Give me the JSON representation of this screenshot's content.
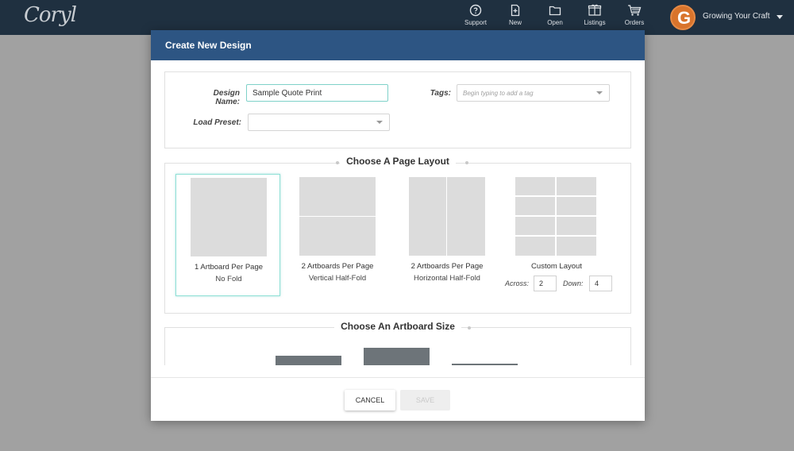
{
  "app": {
    "logo_text": "Coryl"
  },
  "nav": {
    "items": [
      {
        "label": "Support",
        "icon": "question-circle-icon"
      },
      {
        "label": "New",
        "icon": "new-file-icon"
      },
      {
        "label": "Open",
        "icon": "folder-icon"
      },
      {
        "label": "Listings",
        "icon": "box-icon"
      },
      {
        "label": "Orders",
        "icon": "cart-icon"
      }
    ],
    "user": {
      "avatar_letter": "G",
      "name": "Growing Your Craft"
    }
  },
  "modal": {
    "title": "Create New Design",
    "form": {
      "design_name_label": "Design Name:",
      "design_name_value": "Sample Quote Print",
      "load_preset_label": "Load Preset:",
      "load_preset_value": "",
      "tags_label": "Tags:",
      "tags_placeholder": "Begin typing to add a tag"
    },
    "layout_section": {
      "heading": "Choose A Page Layout",
      "options": [
        {
          "title": "1 Artboard Per Page",
          "subtitle": "No Fold",
          "selected": true
        },
        {
          "title": "2 Artboards Per Page",
          "subtitle": "Vertical Half-Fold",
          "selected": false
        },
        {
          "title": "2 Artboards Per Page",
          "subtitle": "Horizontal Half-Fold",
          "selected": false
        },
        {
          "title": "Custom Layout",
          "across_label": "Across:",
          "across_value": "2",
          "down_label": "Down:",
          "down_value": "4",
          "selected": false
        }
      ]
    },
    "size_section": {
      "heading": "Choose An Artboard Size"
    },
    "footer": {
      "cancel_label": "CANCEL",
      "save_label": "SAVE"
    }
  },
  "colors": {
    "topbar": "#1f3040",
    "modal_header": "#2d5583",
    "accent_teal": "#7fd1c9",
    "avatar": "#d9742c"
  }
}
